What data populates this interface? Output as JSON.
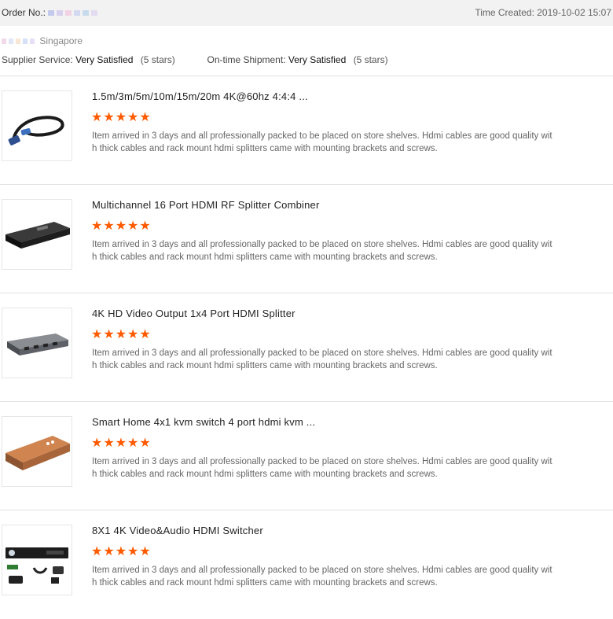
{
  "header": {
    "order_label": "Order No.:",
    "time_created": "Time Created: 2019-10-02 15:07",
    "country": "Singapore",
    "supplier_service_label": "Supplier Service:",
    "supplier_service_value": "Very Satisfied",
    "supplier_service_stars": "(5 stars)",
    "ontime_label": "On-time Shipment:",
    "ontime_value": "Very Satisfied",
    "ontime_stars": "(5 stars)"
  },
  "colors": {
    "star": "#ff5a00",
    "topbar": "#f2f2f2"
  },
  "reviews": [
    {
      "title": "1.5m/3m/5m/10m/15m/20m 4K@60hz 4:4:4 ...",
      "rating": 5,
      "stars": "★★★★★",
      "text": "Item arrived in 3 days and all professionally packed to be placed on store shelves. Hdmi cables are good quality with thick cables and rack mount hdmi splitters came with mounting brackets and screws.",
      "image_icon": "hdmi-cable-icon"
    },
    {
      "title": "Multichannel 16 Port HDMI RF Splitter Combiner",
      "rating": 5,
      "stars": "★★★★★",
      "text": "Item arrived in 3 days and all professionally packed to be placed on store shelves. Hdmi cables are good quality with thick cables and rack mount hdmi splitters came with mounting brackets and screws.",
      "image_icon": "rack-splitter-icon"
    },
    {
      "title": "4K HD Video Output 1x4 Port HDMI Splitter",
      "rating": 5,
      "stars": "★★★★★",
      "text": "Item arrived in 3 days and all professionally packed to be placed on store shelves. Hdmi cables are good quality with thick cables and rack mount hdmi splitters came with mounting brackets and screws.",
      "image_icon": "hdmi-splitter-icon"
    },
    {
      "title": "Smart Home 4x1 kvm switch 4 port hdmi kvm ...",
      "rating": 5,
      "stars": "★★★★★",
      "text": "Item arrived in 3 days and all professionally packed to be placed on store shelves. Hdmi cables are good quality with thick cables and rack mount hdmi splitters came with mounting brackets and screws.",
      "image_icon": "kvm-switch-icon"
    },
    {
      "title": "8X1 4K Video&Audio HDMI Switcher",
      "rating": 5,
      "stars": "★★★★★",
      "text": "Item arrived in 3 days and all professionally packed to be placed on store shelves. Hdmi cables are good quality with thick cables and rack mount hdmi splitters came with mounting brackets and screws.",
      "image_icon": "hdmi-switcher-kit-icon"
    }
  ]
}
